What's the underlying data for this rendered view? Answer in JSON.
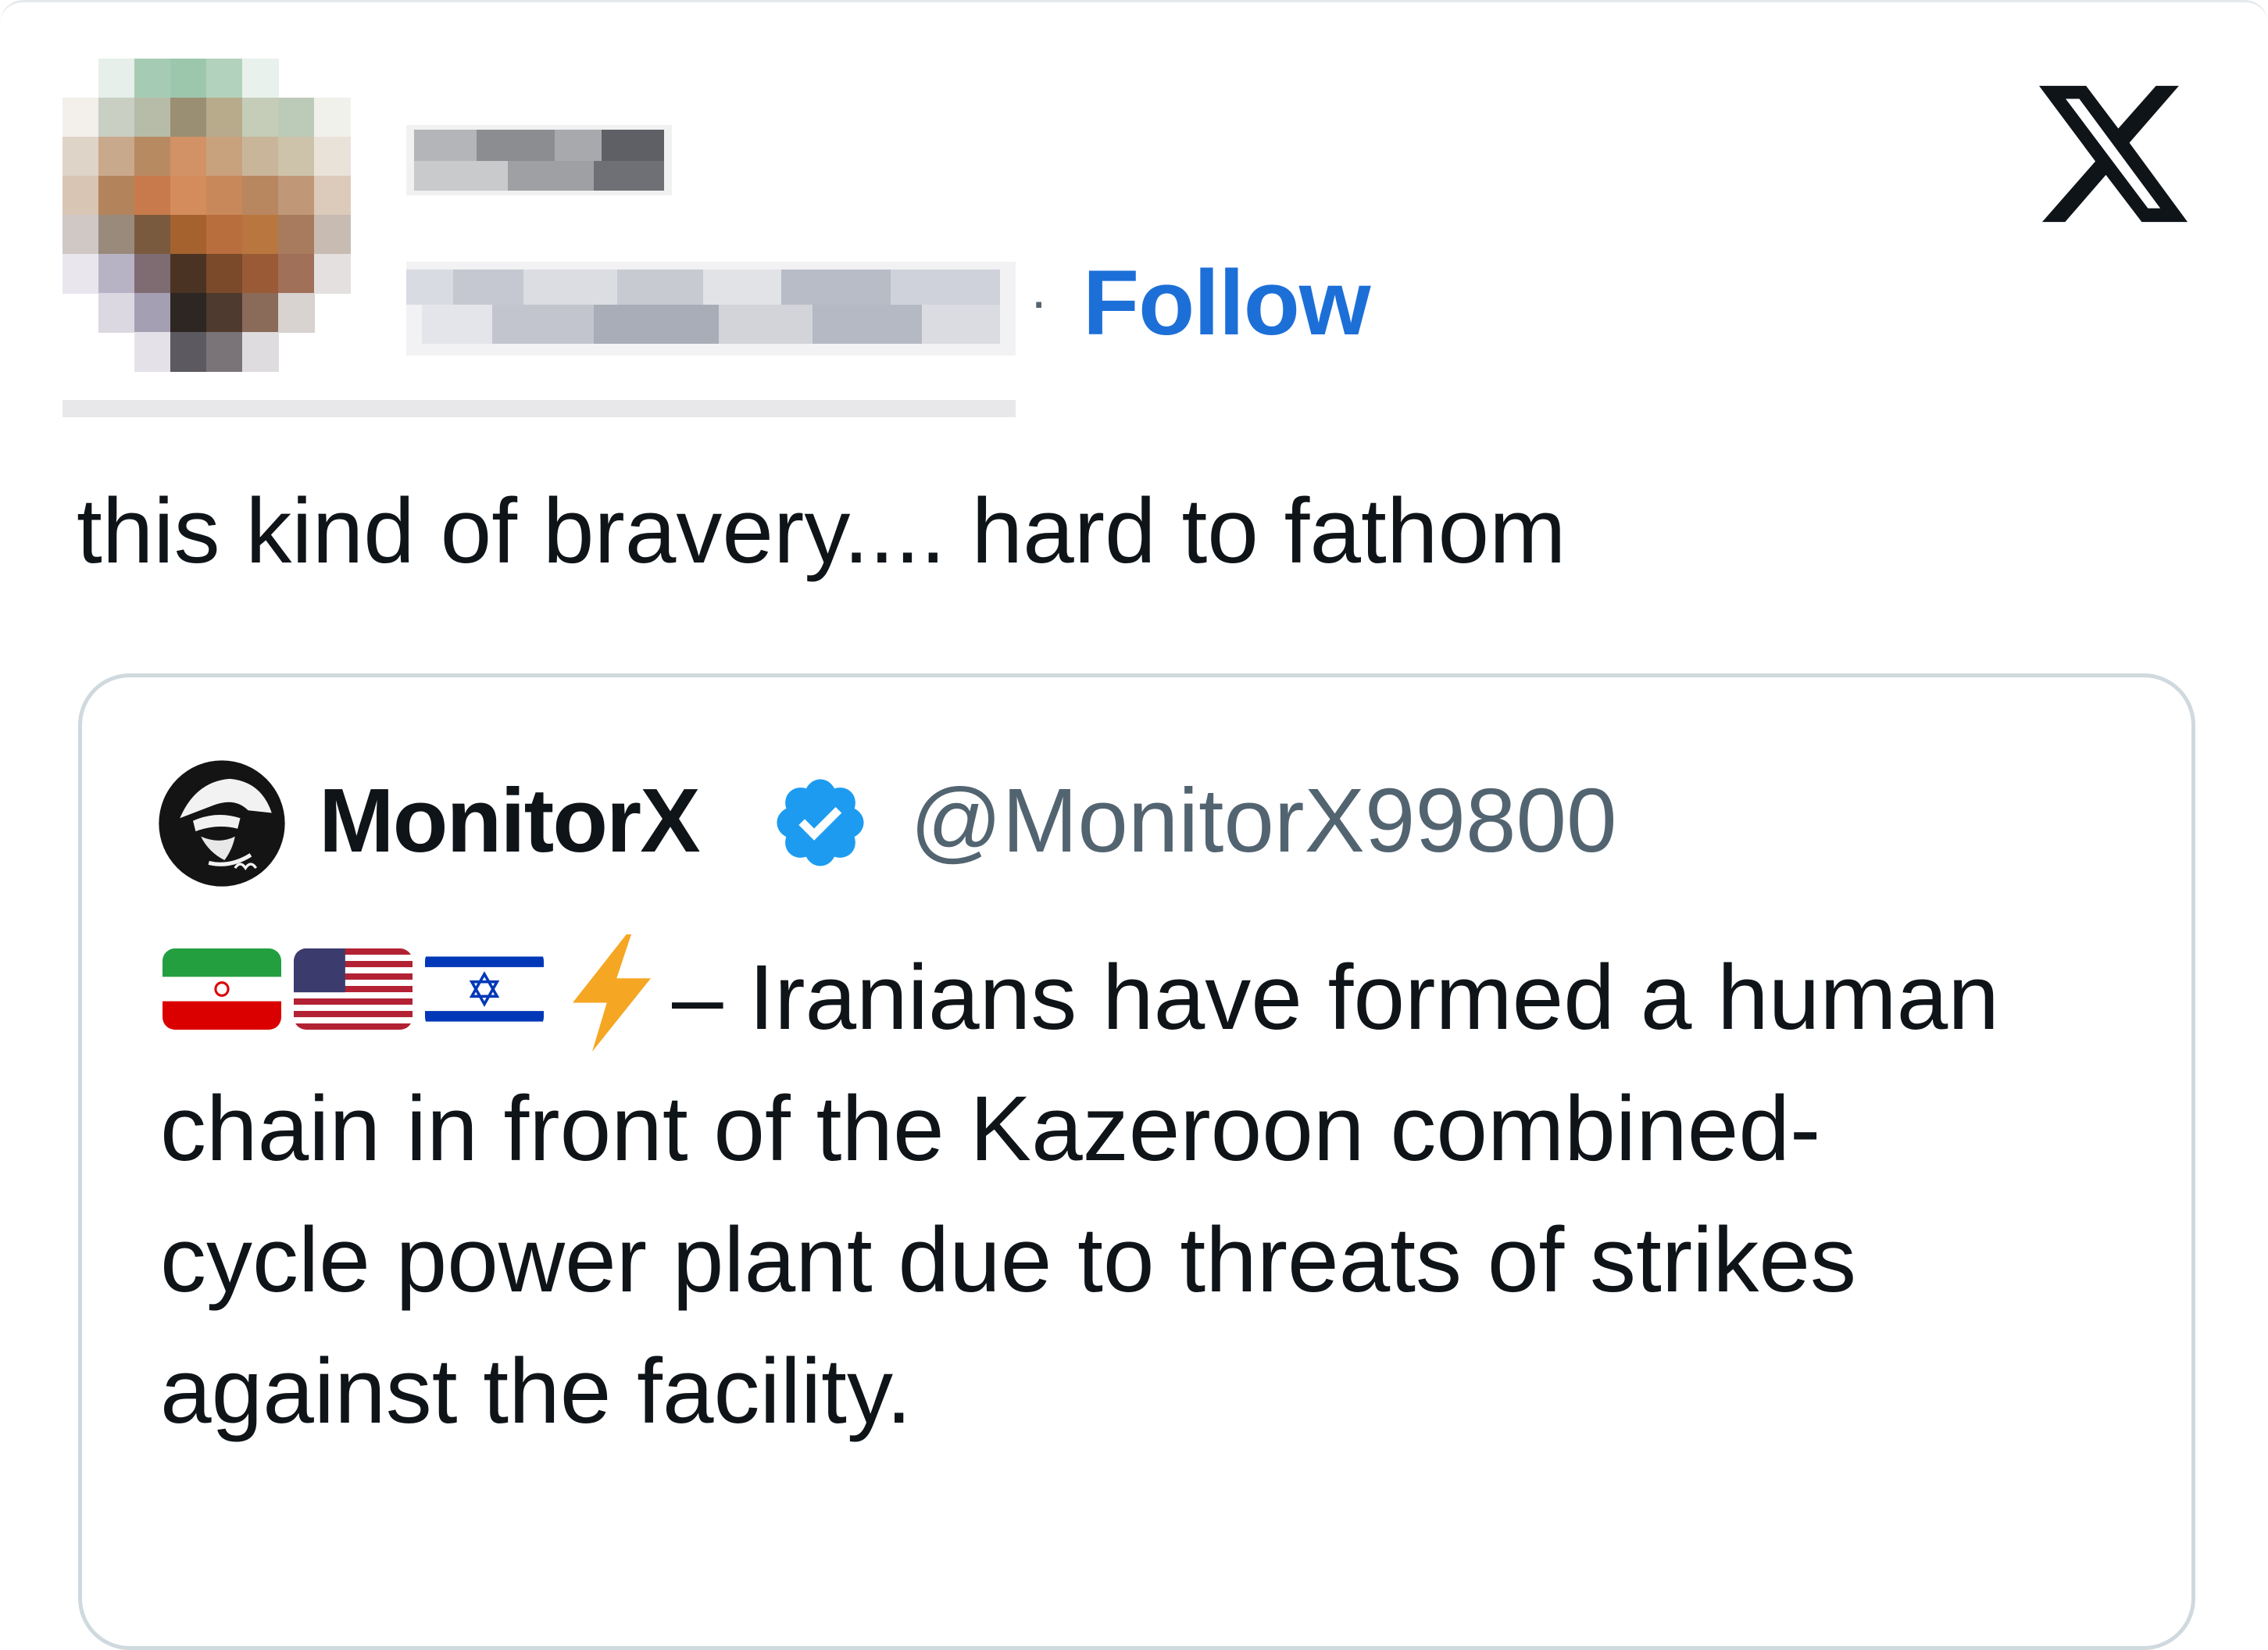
{
  "header": {
    "separator": "·",
    "follow_label": "Follow"
  },
  "tweet": {
    "text": "this kind of bravery.... hard to fathom"
  },
  "quoted_tweet": {
    "display_name": "MonitorX",
    "handle": "@MonitorX99800",
    "verified": true,
    "emoji_prefix": [
      "flag-iran-icon",
      "flag-usa-icon",
      "flag-israel-icon",
      "lightning-icon"
    ],
    "lines": [
      "– Iranians have formed a human",
      "chain in front of the Kazeroon combined-",
      "cycle power plant due to threats of strikes",
      "against the facility."
    ]
  },
  "colors": {
    "follow_link": "#1d6fd8",
    "verified_badge": "#1d9bf0",
    "handle_gray": "#536471",
    "text": "#0f1419",
    "quote_border": "#cfd9de"
  }
}
